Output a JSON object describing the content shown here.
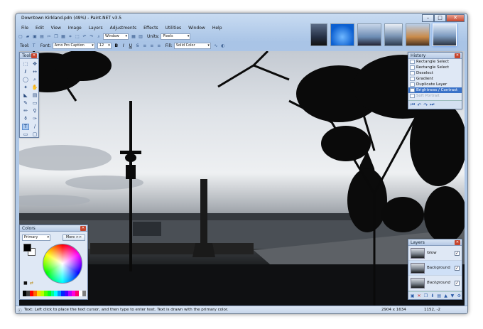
{
  "window": {
    "title": "Downtown Kirkland.pdn (49%) - Paint.NET v3.5",
    "controls": {
      "minimize": "–",
      "maximize": "□",
      "close": "✕"
    }
  },
  "menu": [
    "File",
    "Edit",
    "View",
    "Image",
    "Layers",
    "Adjustments",
    "Effects",
    "Utilities",
    "Window",
    "Help"
  ],
  "toolbar1": {
    "window_dropdown": "Window",
    "units_label": "Units:",
    "units_value": "Pixels"
  },
  "toolbar2": {
    "tool_label": "Tool:",
    "font_label": "Font:",
    "font_value": "Arno Pro Caption",
    "size_value": "12",
    "bold": "B",
    "italic": "I",
    "underline": "U",
    "fill_label": "Fill:",
    "fill_value": "Solid Color"
  },
  "tools_panel": {
    "title": "Tools"
  },
  "history_panel": {
    "title": "History",
    "items": [
      {
        "label": "Rectangle Select",
        "state": "normal"
      },
      {
        "label": "Rectangle Select",
        "state": "normal"
      },
      {
        "label": "Deselect",
        "state": "normal"
      },
      {
        "label": "Gradient",
        "state": "normal"
      },
      {
        "label": "Duplicate Layer",
        "state": "normal"
      },
      {
        "label": "Brightness / Contrast",
        "state": "selected"
      },
      {
        "label": "Soft Portrait",
        "state": "undone"
      }
    ]
  },
  "colors_panel": {
    "title": "Colors",
    "mode": "Primary",
    "more_button": "More >>",
    "primary_color": "#000000",
    "secondary_color": "#ffffff"
  },
  "layers_panel": {
    "title": "Layers",
    "items": [
      {
        "name": "Glow",
        "visible": true,
        "italic": false
      },
      {
        "name": "Background",
        "visible": true,
        "italic": false
      },
      {
        "name": "Background",
        "visible": true,
        "italic": true
      }
    ]
  },
  "status": {
    "hint": "Text: Left click to place the text cursor, and then type to enter text. Text is drawn with the primary color.",
    "image_size": "2904 x 1634",
    "cursor_position": "1152, -2"
  },
  "palette": [
    "#000000",
    "#404040",
    "#ff0000",
    "#ff6a00",
    "#ffd800",
    "#b6ff00",
    "#4cff00",
    "#00ff21",
    "#00ff90",
    "#00ffff",
    "#0094ff",
    "#0026ff",
    "#4800ff",
    "#b200ff",
    "#ff00dc",
    "#ff006e",
    "#ffffff",
    "#808080"
  ]
}
